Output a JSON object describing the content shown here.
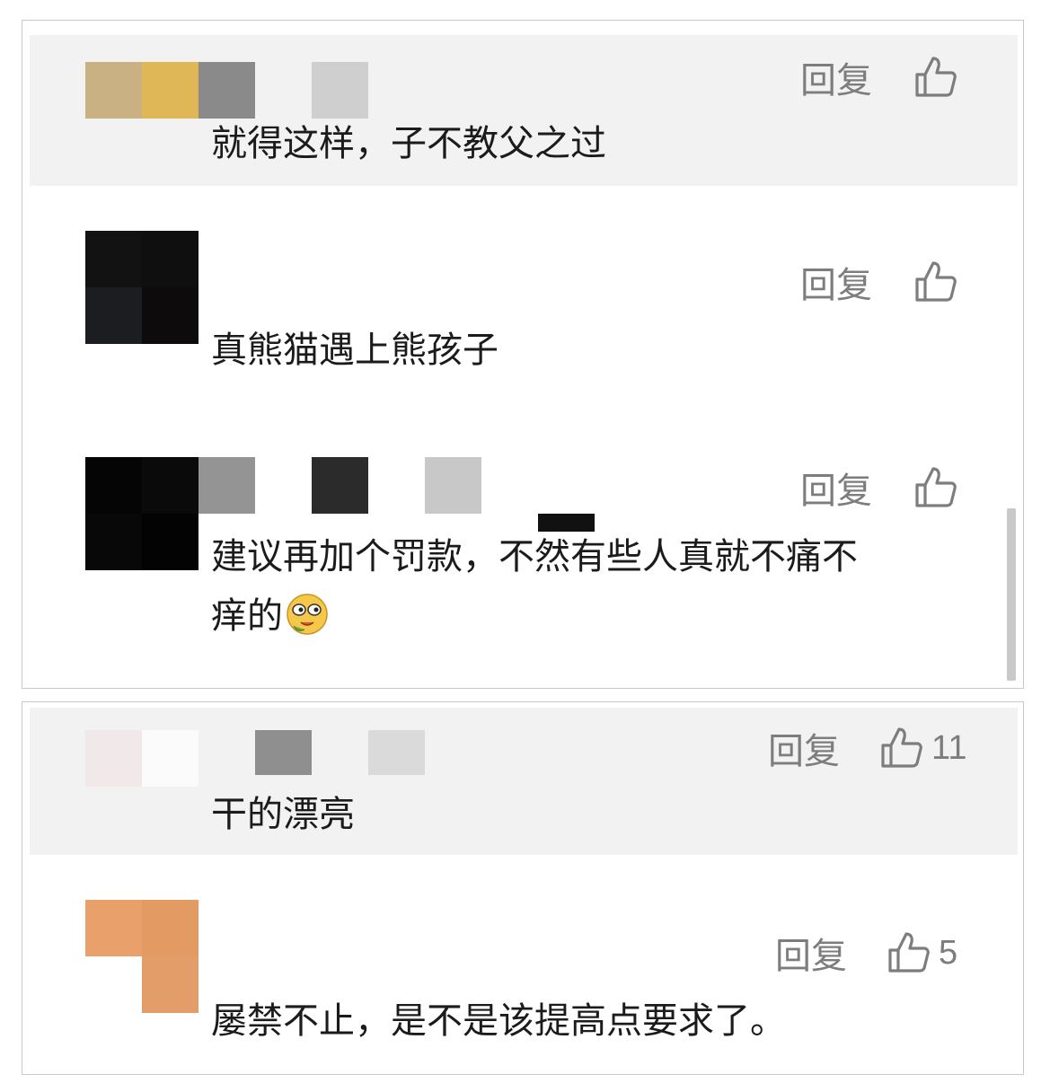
{
  "icons": {
    "like": "thumbs-up-icon",
    "emoji": "smirk-emoji-icon"
  },
  "colors": {
    "highlight_bg": "#f2f2f2",
    "text": "#1b1b1b",
    "action": "#7d7d7d"
  },
  "panel1": {
    "comments": [
      {
        "text": "就得这样，子不教父之过",
        "reply": "回复"
      },
      {
        "text": "真熊猫遇上熊孩子",
        "reply": "回复"
      },
      {
        "text_line1": "建议再加个罚款，不然有些人真就不痛不",
        "text_line2": "痒的",
        "reply": "回复"
      }
    ]
  },
  "panel2": {
    "comments": [
      {
        "text": "干的漂亮",
        "reply": "回复",
        "likes": "11"
      },
      {
        "text": "屡禁不止，是不是该提高点要求了。",
        "reply": "回复",
        "likes": "5"
      }
    ]
  }
}
